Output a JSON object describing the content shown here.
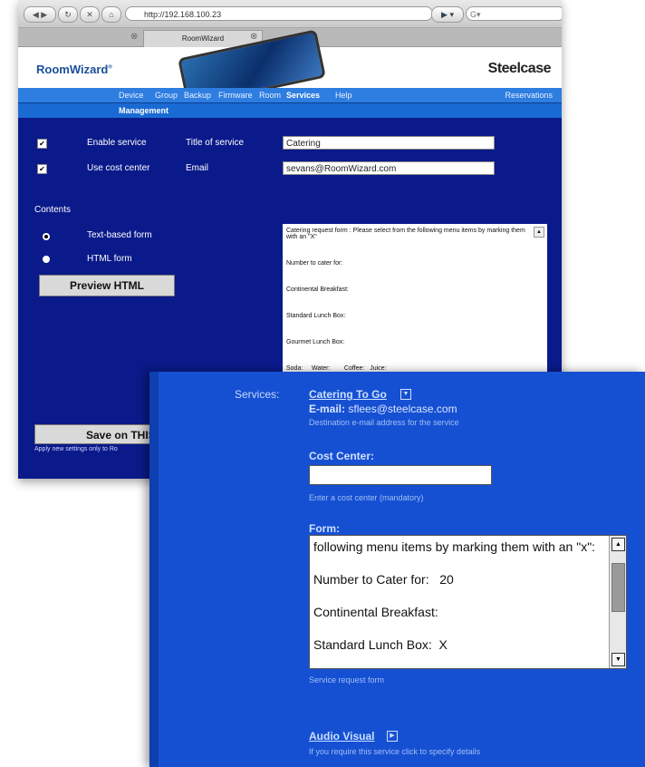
{
  "browser": {
    "url": "http://192.168.100.23",
    "tab_title": "RoomWizard",
    "url_dropdown": "▶ ▾",
    "search_placeholder": "G▾"
  },
  "roomwizard": {
    "logo": "RoomWizard",
    "brand": "Steelcase",
    "nav": [
      "Device",
      "Group",
      "Backup",
      "Firmware",
      "Room",
      "Services",
      "Help"
    ],
    "nav_active": "Services",
    "nav_right": "Reservations",
    "subnav": "Management",
    "enable_service": "Enable service",
    "use_cost_center": "Use cost center",
    "title_label": "Title of service",
    "title_value": "Catering",
    "email_label": "Email",
    "email_value": "sevans@RoomWizard.com",
    "contents_label": "Contents",
    "opt_text": "Text-based form",
    "opt_html": "HTML form",
    "preview_button": "Preview HTML",
    "save_button": "Save on THIS",
    "apply_note": "Apply new settings only to Ro",
    "form_lines": [
      "Catering request form : Please select from the following menu items by marking them with an \"X\"",
      "Number to cater for:",
      "Continental Breakfast:",
      "Standard Lunch Box:",
      "Gourmet Lunch Box:",
      "Soda:     Water:        Coffee:   Juice:"
    ]
  },
  "services_panel": {
    "services_label": "Services:",
    "service_name": "Catering To Go",
    "email_label": "E-mail:",
    "email_value": "sflees@steelcase.com",
    "email_hint": "Destination e-mail address for the service",
    "cost_center_label": "Cost Center:",
    "cost_center_hint": "Enter a cost center (mandatory)",
    "form_label": "Form:",
    "form_lines": [
      "following menu items by marking them with an \"x\":",
      "Number to Cater for:   20",
      "Continental Breakfast:",
      "Standard Lunch Box:  X"
    ],
    "form_hint": "Service request form",
    "audio_visual": "Audio Visual",
    "audio_hint": "If you require this service click to specify details"
  }
}
